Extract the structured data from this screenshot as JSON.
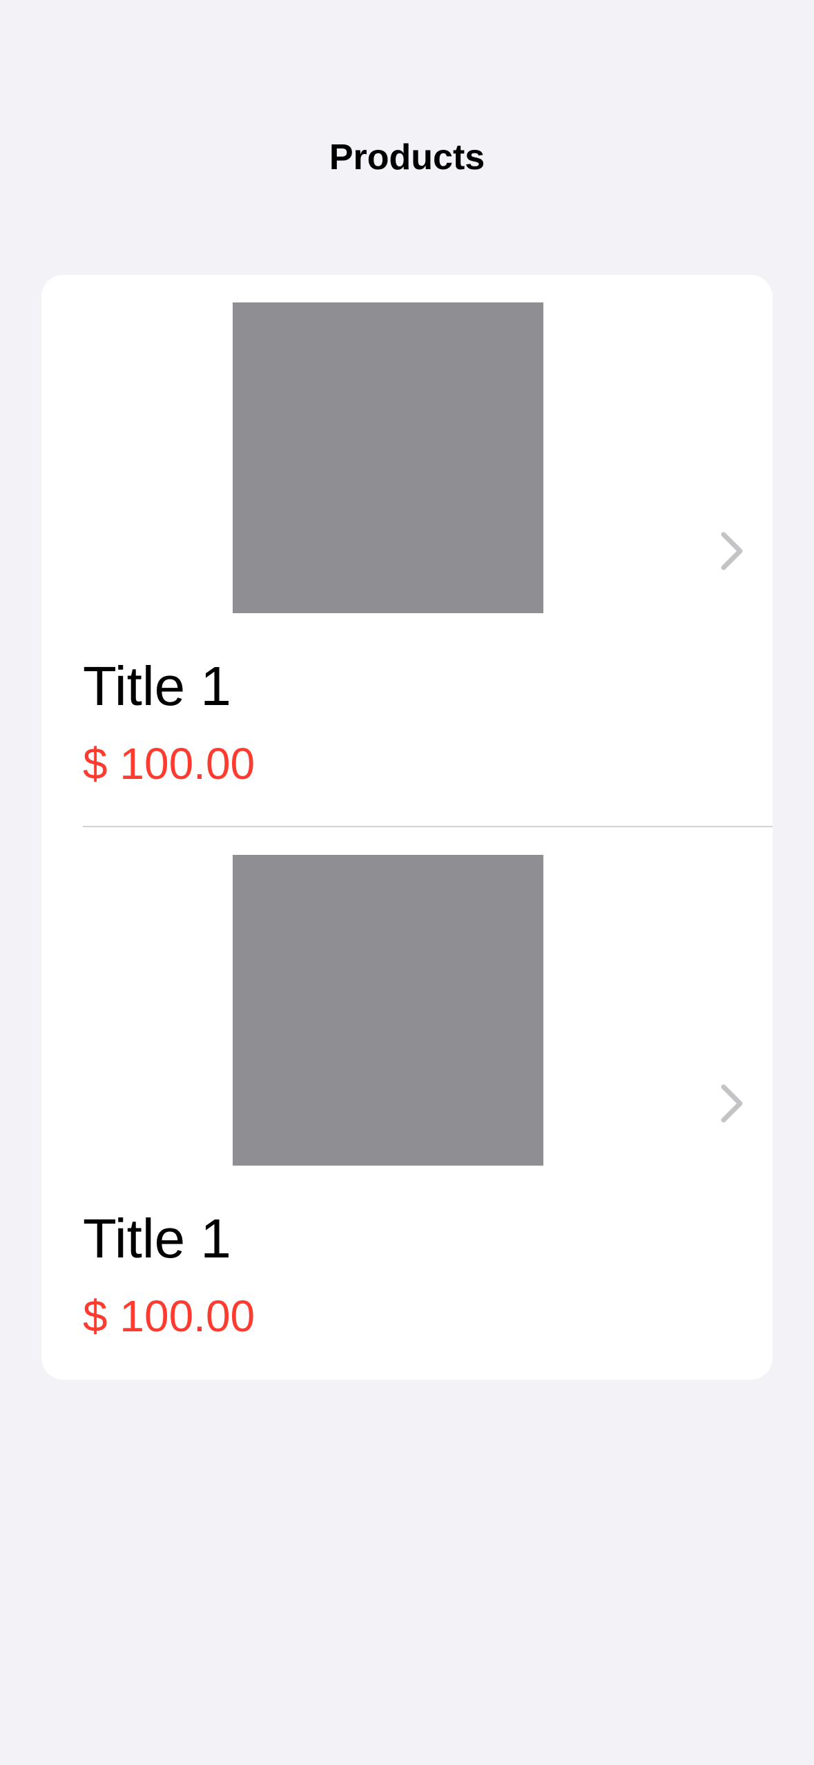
{
  "nav": {
    "title": "Products"
  },
  "colors": {
    "background": "#f2f2f7",
    "card": "#ffffff",
    "thumbnail": "#8e8e93",
    "price": "#ff3b30",
    "chevron": "#c4c4c7"
  },
  "products": [
    {
      "title": "Title 1",
      "price": "$ 100.00",
      "image_icon": "image-placeholder",
      "disclosure_icon": "chevron-right-icon"
    },
    {
      "title": "Title 1",
      "price": "$ 100.00",
      "image_icon": "image-placeholder",
      "disclosure_icon": "chevron-right-icon"
    }
  ]
}
